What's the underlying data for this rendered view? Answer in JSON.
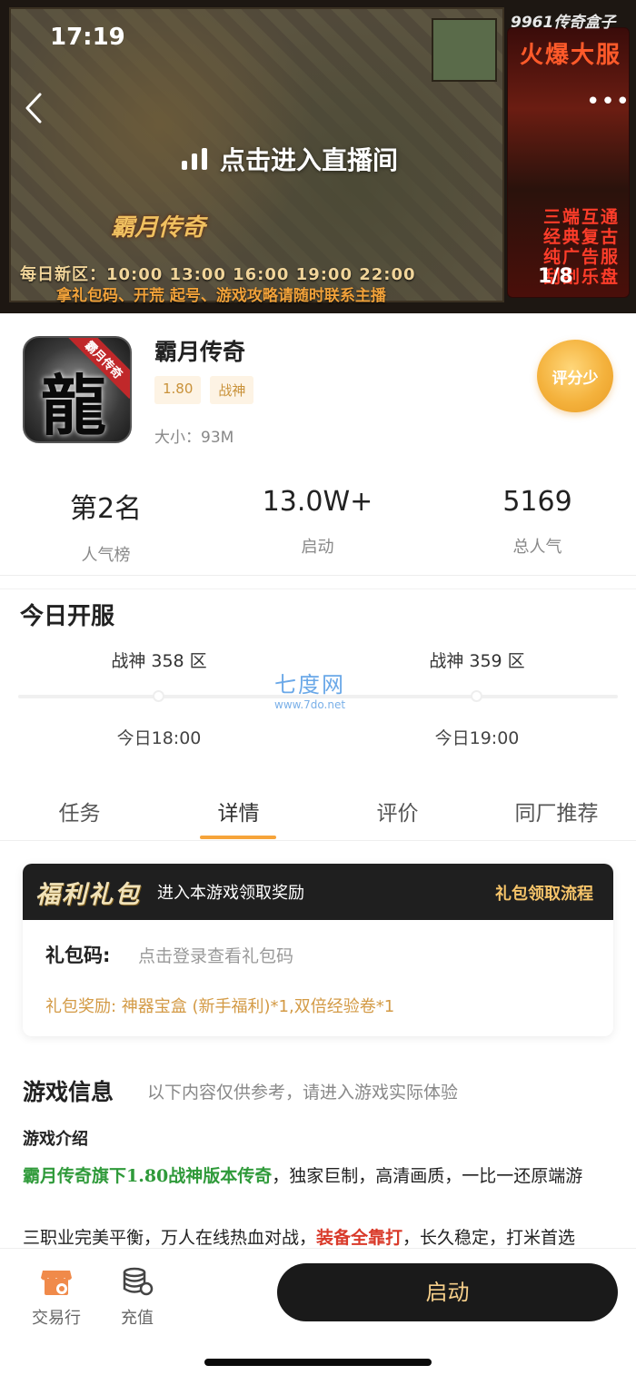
{
  "status": {
    "time": "17:19"
  },
  "hero": {
    "live_label": "点击进入直播间",
    "daily_line": "每日新区：10:00  13:00  16:00  19:00  22:00",
    "promo_line": "拿礼包码、开荒 起号、游戏攻略请随时联系主播",
    "logo_text": "霸月传奇",
    "side_title": "火爆大服",
    "side_lines": "三端互通 经典复古 纯广告服 刮刮乐盘",
    "brand": "9961传奇盒子",
    "page_indicator": "1/8"
  },
  "app": {
    "name": "霸月传奇",
    "icon_char": "龍",
    "icon_ribbon": "霸月传奇",
    "tags": [
      "1.80",
      "战神"
    ],
    "size": "大小：93M",
    "rating_label": "评分少"
  },
  "stats": [
    {
      "value": "第2名",
      "label": "人气榜"
    },
    {
      "value": "13.0W+",
      "label": "启动"
    },
    {
      "value": "5169",
      "label": "总人气"
    }
  ],
  "today_open": {
    "title": "今日开服",
    "servers": [
      {
        "name": "战神 358 区",
        "time": "今日18:00"
      },
      {
        "name": "战神 359 区",
        "time": "今日19:00"
      }
    ],
    "watermark_big": "七度网",
    "watermark_small": "www.7do.net"
  },
  "tabs": [
    "任务",
    "详情",
    "评价",
    "同厂推荐"
  ],
  "active_tab": "详情",
  "gift": {
    "logo": "福利礼包",
    "subtitle": "进入本游戏领取奖励",
    "flow_link": "礼包领取流程",
    "code_label": "礼包码:",
    "code_value": "点击登录查看礼包码",
    "reward": "礼包奖励: 神器宝盒 (新手福利)*1,双倍经验卷*1"
  },
  "game_info": {
    "title": "游戏信息",
    "note": "以下内容仅供参考，请进入游戏实际体验",
    "intro_label": "游戏介绍",
    "para1_highlight": "霸月传奇旗下1.80战神版本传奇",
    "para1_rest": "，独家巨制，高清画质，一比一还原端游",
    "para2_start": "三职业完美平衡，万人在线热血对战，",
    "para2_highlight": "装备全靠打",
    "para2_end": "，长久稳定，打米首选"
  },
  "bottom_bar": {
    "trade_label": "交易行",
    "recharge_label": "充值",
    "launch_label": "启动"
  },
  "colors": {
    "accent_orange": "#f6a43a",
    "tag_text": "#c9923a",
    "highlight_green": "#2f9a3a",
    "highlight_red": "#d93a2a",
    "launch_text": "#f6cf8a"
  }
}
